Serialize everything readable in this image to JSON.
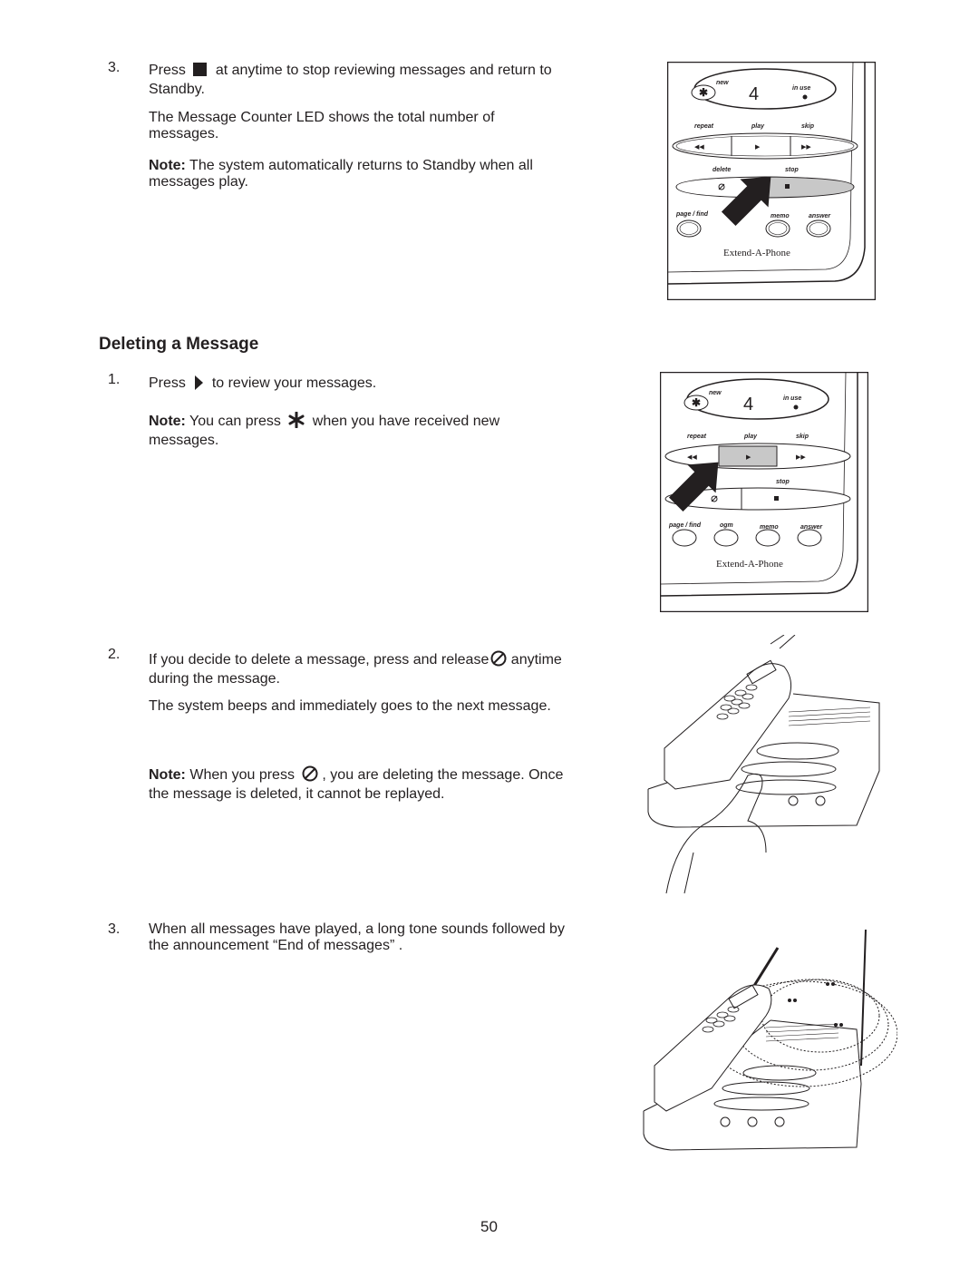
{
  "page_number": "50",
  "top_step": {
    "number": "3.",
    "line1_before": "Press",
    "line1_after": "at anytime to stop reviewing messages and return to Standby.",
    "icon": "stop-square-icon",
    "para2": "The Message Counter LED shows the total number of messages.",
    "note_label": "Note:",
    "note_text": " The system automatically returns to Standby when all messages play."
  },
  "section": {
    "title": "Deleting a Message",
    "steps": [
      {
        "number": "1.",
        "before": "Press",
        "icon": "play-triangle-icon",
        "after": "to review your messages.",
        "note_label": "Note:",
        "note_before": " You can press",
        "note_icon": "asterisk-icon",
        "note_after": "when you have received new messages."
      },
      {
        "number": "2.",
        "before": "If you decide to delete a message, press and release",
        "icon": "delete-slash-circle-icon",
        "after": "anytime during the message.",
        "para2": "The system beeps and immediately goes to the next message.",
        "note_label": "Note:",
        "note_before": " When you press",
        "note_icon": "delete-slash-circle-icon",
        "note_after": ", you are deleting the message. Once the message is deleted, it cannot be replayed."
      },
      {
        "number": "3.",
        "text": "When all messages have played, a long tone sounds followed by the announcement “End of messages” ."
      }
    ]
  },
  "panel": {
    "counter": "4",
    "labels": {
      "new": "new",
      "in_use": "in use",
      "repeat": "repeat",
      "play": "play",
      "skip": "skip",
      "delete": "delete",
      "stop": "stop",
      "page_find": "page / find",
      "ogm": "ogm",
      "memo": "memo",
      "answer": "answer"
    },
    "brand": "Extend-A-Phone",
    "highlight_fig1": "stop",
    "highlight_fig2": "play",
    "highlight_color": "#c8c8c8"
  },
  "illustrations": {
    "fig3": "hand-pressing-delete-on-base-illustration",
    "fig4": "base-sounding-tone-illustration"
  }
}
